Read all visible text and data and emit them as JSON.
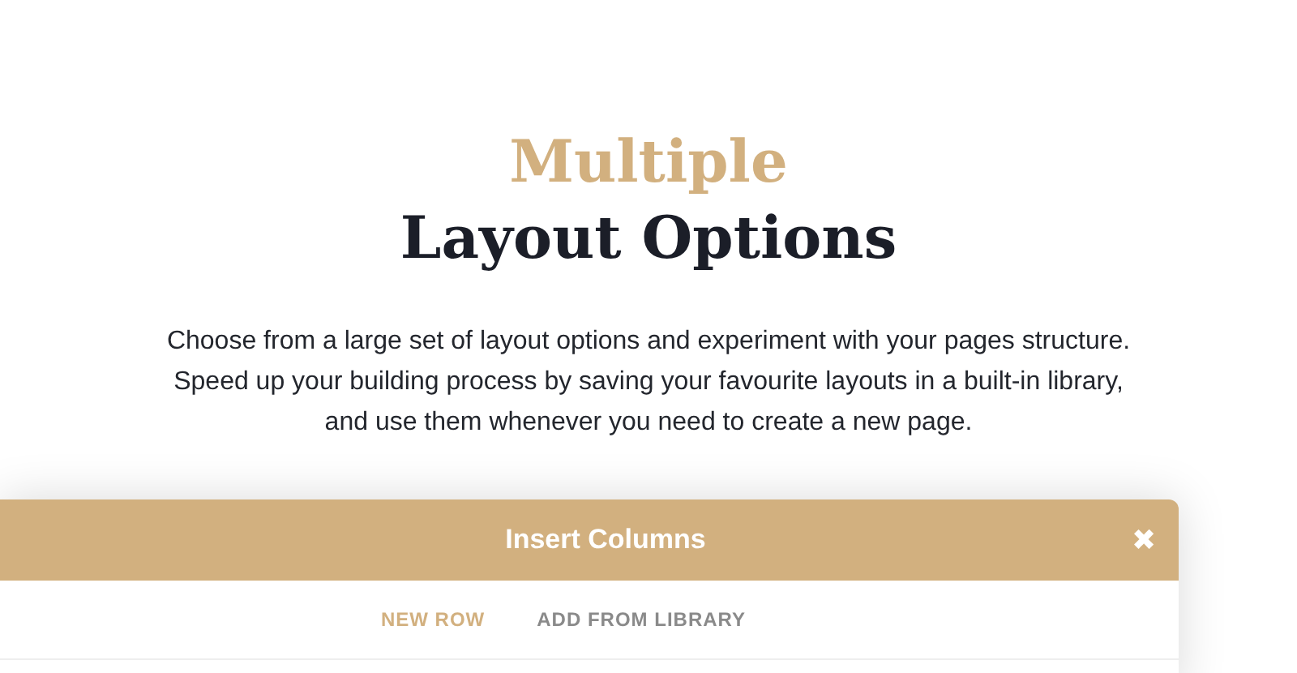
{
  "heading": {
    "accent": "Multiple",
    "title": "Layout Options"
  },
  "description": "Choose from a large set of layout options and experiment with your pages structure. Speed up your building process by saving your favourite layouts in a built-in library, and use them whenever you need to create a new page.",
  "modal": {
    "title": "Insert Columns",
    "close": "✖",
    "tabs": [
      {
        "label": "NEW ROW",
        "selected": true
      },
      {
        "label": "ADD FROM LIBRARY",
        "selected": false
      }
    ]
  }
}
